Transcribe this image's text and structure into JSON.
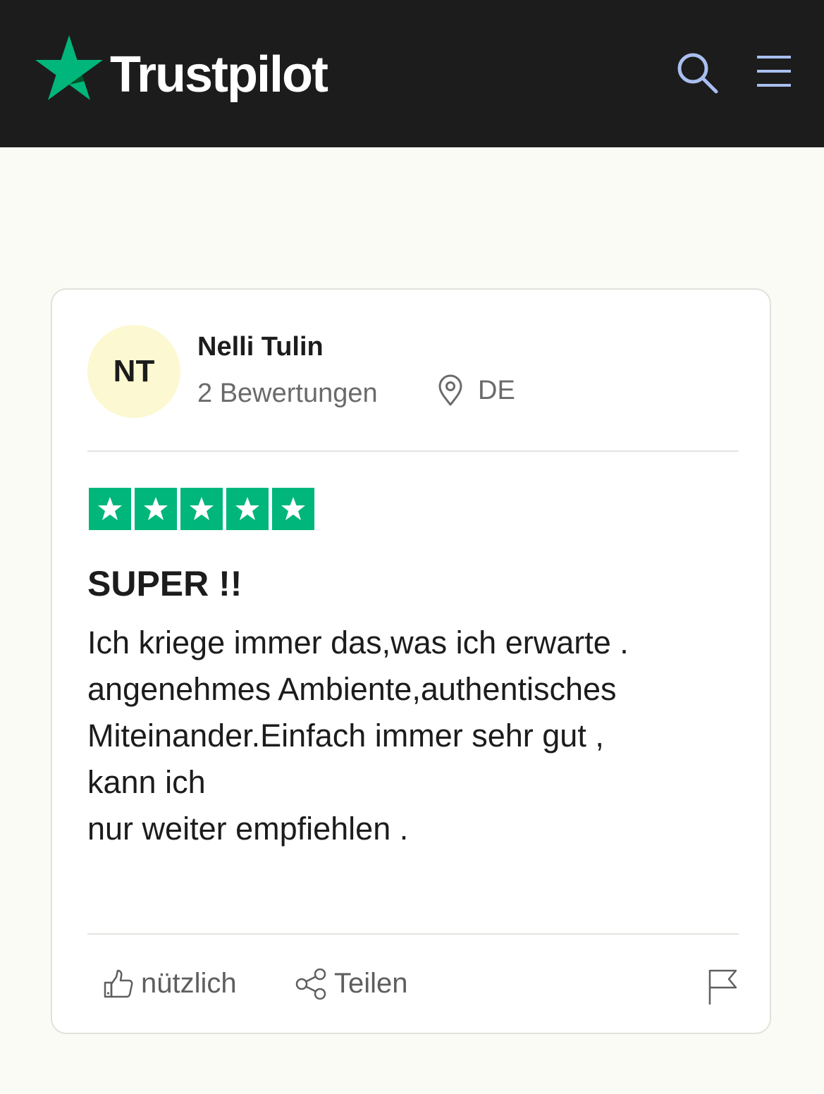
{
  "header": {
    "brand": "Trustpilot",
    "brand_color": "#00b67a",
    "background": "#1c1c1c",
    "search_icon": "search-icon",
    "menu_icon": "hamburger-menu-icon",
    "icon_color": "#a9bff0"
  },
  "review": {
    "avatar_initials": "NT",
    "reviewer_name": "Nelli Tulin",
    "reviews_count": "2 Bewertungen",
    "country": "DE",
    "rating": 5,
    "rating_max": 5,
    "title": "SUPER !!",
    "body_lines": [
      "Ich kriege immer das,was ich erwarte .",
      "angenehmes Ambiente,authentisches",
      "Miteinander.Einfach immer sehr gut ,",
      "kann ich",
      "nur weiter empfiehlen ."
    ]
  },
  "actions": {
    "useful_label": "nützlich",
    "share_label": "Teilen",
    "useful_icon": "thumbs-up-icon",
    "share_icon": "share-icon",
    "report_icon": "flag-icon"
  }
}
